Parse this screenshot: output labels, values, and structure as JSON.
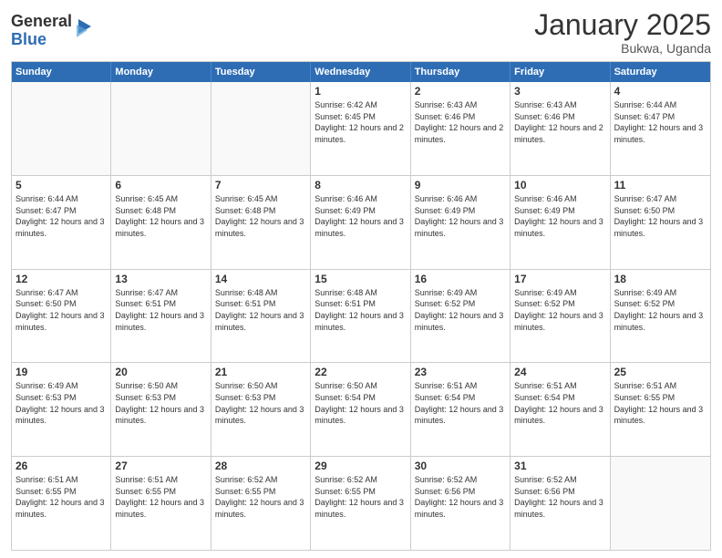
{
  "logo": {
    "general": "General",
    "blue": "Blue"
  },
  "header": {
    "month": "January 2025",
    "location": "Bukwa, Uganda"
  },
  "weekdays": [
    "Sunday",
    "Monday",
    "Tuesday",
    "Wednesday",
    "Thursday",
    "Friday",
    "Saturday"
  ],
  "rows": [
    [
      {
        "day": "",
        "empty": true
      },
      {
        "day": "",
        "empty": true
      },
      {
        "day": "",
        "empty": true
      },
      {
        "day": "1",
        "sunrise": "Sunrise: 6:42 AM",
        "sunset": "Sunset: 6:45 PM",
        "daylight": "Daylight: 12 hours and 2 minutes."
      },
      {
        "day": "2",
        "sunrise": "Sunrise: 6:43 AM",
        "sunset": "Sunset: 6:46 PM",
        "daylight": "Daylight: 12 hours and 2 minutes."
      },
      {
        "day": "3",
        "sunrise": "Sunrise: 6:43 AM",
        "sunset": "Sunset: 6:46 PM",
        "daylight": "Daylight: 12 hours and 2 minutes."
      },
      {
        "day": "4",
        "sunrise": "Sunrise: 6:44 AM",
        "sunset": "Sunset: 6:47 PM",
        "daylight": "Daylight: 12 hours and 3 minutes."
      }
    ],
    [
      {
        "day": "5",
        "sunrise": "Sunrise: 6:44 AM",
        "sunset": "Sunset: 6:47 PM",
        "daylight": "Daylight: 12 hours and 3 minutes."
      },
      {
        "day": "6",
        "sunrise": "Sunrise: 6:45 AM",
        "sunset": "Sunset: 6:48 PM",
        "daylight": "Daylight: 12 hours and 3 minutes."
      },
      {
        "day": "7",
        "sunrise": "Sunrise: 6:45 AM",
        "sunset": "Sunset: 6:48 PM",
        "daylight": "Daylight: 12 hours and 3 minutes."
      },
      {
        "day": "8",
        "sunrise": "Sunrise: 6:46 AM",
        "sunset": "Sunset: 6:49 PM",
        "daylight": "Daylight: 12 hours and 3 minutes."
      },
      {
        "day": "9",
        "sunrise": "Sunrise: 6:46 AM",
        "sunset": "Sunset: 6:49 PM",
        "daylight": "Daylight: 12 hours and 3 minutes."
      },
      {
        "day": "10",
        "sunrise": "Sunrise: 6:46 AM",
        "sunset": "Sunset: 6:49 PM",
        "daylight": "Daylight: 12 hours and 3 minutes."
      },
      {
        "day": "11",
        "sunrise": "Sunrise: 6:47 AM",
        "sunset": "Sunset: 6:50 PM",
        "daylight": "Daylight: 12 hours and 3 minutes."
      }
    ],
    [
      {
        "day": "12",
        "sunrise": "Sunrise: 6:47 AM",
        "sunset": "Sunset: 6:50 PM",
        "daylight": "Daylight: 12 hours and 3 minutes."
      },
      {
        "day": "13",
        "sunrise": "Sunrise: 6:47 AM",
        "sunset": "Sunset: 6:51 PM",
        "daylight": "Daylight: 12 hours and 3 minutes."
      },
      {
        "day": "14",
        "sunrise": "Sunrise: 6:48 AM",
        "sunset": "Sunset: 6:51 PM",
        "daylight": "Daylight: 12 hours and 3 minutes."
      },
      {
        "day": "15",
        "sunrise": "Sunrise: 6:48 AM",
        "sunset": "Sunset: 6:51 PM",
        "daylight": "Daylight: 12 hours and 3 minutes."
      },
      {
        "day": "16",
        "sunrise": "Sunrise: 6:49 AM",
        "sunset": "Sunset: 6:52 PM",
        "daylight": "Daylight: 12 hours and 3 minutes."
      },
      {
        "day": "17",
        "sunrise": "Sunrise: 6:49 AM",
        "sunset": "Sunset: 6:52 PM",
        "daylight": "Daylight: 12 hours and 3 minutes."
      },
      {
        "day": "18",
        "sunrise": "Sunrise: 6:49 AM",
        "sunset": "Sunset: 6:52 PM",
        "daylight": "Daylight: 12 hours and 3 minutes."
      }
    ],
    [
      {
        "day": "19",
        "sunrise": "Sunrise: 6:49 AM",
        "sunset": "Sunset: 6:53 PM",
        "daylight": "Daylight: 12 hours and 3 minutes."
      },
      {
        "day": "20",
        "sunrise": "Sunrise: 6:50 AM",
        "sunset": "Sunset: 6:53 PM",
        "daylight": "Daylight: 12 hours and 3 minutes."
      },
      {
        "day": "21",
        "sunrise": "Sunrise: 6:50 AM",
        "sunset": "Sunset: 6:53 PM",
        "daylight": "Daylight: 12 hours and 3 minutes."
      },
      {
        "day": "22",
        "sunrise": "Sunrise: 6:50 AM",
        "sunset": "Sunset: 6:54 PM",
        "daylight": "Daylight: 12 hours and 3 minutes."
      },
      {
        "day": "23",
        "sunrise": "Sunrise: 6:51 AM",
        "sunset": "Sunset: 6:54 PM",
        "daylight": "Daylight: 12 hours and 3 minutes."
      },
      {
        "day": "24",
        "sunrise": "Sunrise: 6:51 AM",
        "sunset": "Sunset: 6:54 PM",
        "daylight": "Daylight: 12 hours and 3 minutes."
      },
      {
        "day": "25",
        "sunrise": "Sunrise: 6:51 AM",
        "sunset": "Sunset: 6:55 PM",
        "daylight": "Daylight: 12 hours and 3 minutes."
      }
    ],
    [
      {
        "day": "26",
        "sunrise": "Sunrise: 6:51 AM",
        "sunset": "Sunset: 6:55 PM",
        "daylight": "Daylight: 12 hours and 3 minutes."
      },
      {
        "day": "27",
        "sunrise": "Sunrise: 6:51 AM",
        "sunset": "Sunset: 6:55 PM",
        "daylight": "Daylight: 12 hours and 3 minutes."
      },
      {
        "day": "28",
        "sunrise": "Sunrise: 6:52 AM",
        "sunset": "Sunset: 6:55 PM",
        "daylight": "Daylight: 12 hours and 3 minutes."
      },
      {
        "day": "29",
        "sunrise": "Sunrise: 6:52 AM",
        "sunset": "Sunset: 6:55 PM",
        "daylight": "Daylight: 12 hours and 3 minutes."
      },
      {
        "day": "30",
        "sunrise": "Sunrise: 6:52 AM",
        "sunset": "Sunset: 6:56 PM",
        "daylight": "Daylight: 12 hours and 3 minutes."
      },
      {
        "day": "31",
        "sunrise": "Sunrise: 6:52 AM",
        "sunset": "Sunset: 6:56 PM",
        "daylight": "Daylight: 12 hours and 3 minutes."
      },
      {
        "day": "",
        "empty": true
      }
    ]
  ]
}
